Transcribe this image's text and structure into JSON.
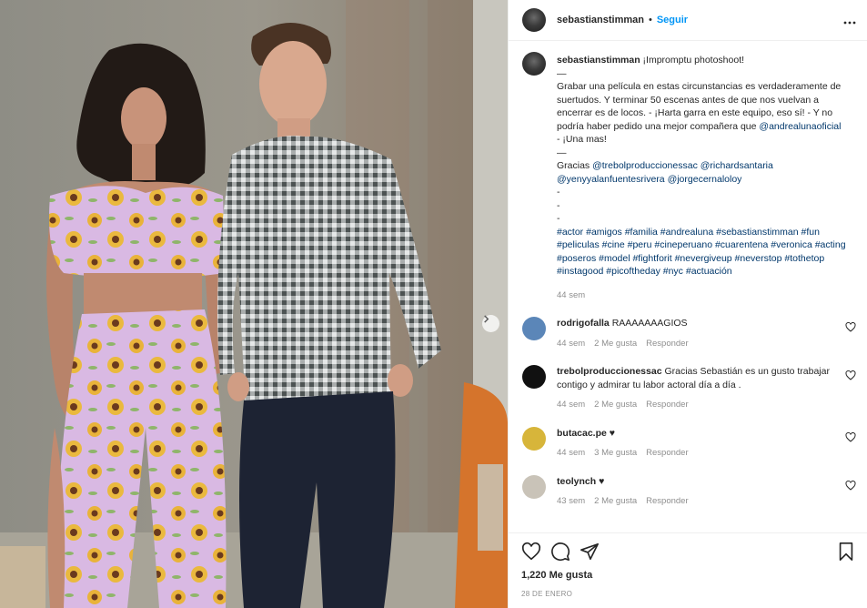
{
  "header": {
    "username": "sebastianstimman",
    "separator": "•",
    "follow_label": "Seguir",
    "more_icon": "more-horizontal-icon"
  },
  "caption": {
    "username": "sebastianstimman",
    "text_1": "¡Impromptu photoshoot!\n—\nGrabar una película en estas circunstancias es verdaderamente de suertudos. Y terminar 50 escenas antes de que nos vuelvan a encerrar es de locos. - ¡Harta garra en este equipo, eso sí! - Y no podría haber pedido una mejor compañera que ",
    "mention_1": "@andrealunaoficial",
    "text_2": "\n- ¡Una mas!\n—\nGracias ",
    "mention_2": "@trebolproduccionessac",
    "mention_3": "@richardsantaria",
    "mention_4": "@yenyyalanfuentesrivera",
    "mention_5": "@jorgecernaloloy",
    "dashes": "-\n-\n-",
    "hashtags": "#actor #amigos #familia #andrealuna #sebastianstimman #fun #peliculas #cine #peru #cineperuano #cuarentena #veronica #acting #poseros #model #fightforit #nevergiveup #neverstop #tothetop #instagood #picoftheday #nyc #actuación",
    "time": "44 sem"
  },
  "comments": [
    {
      "username": "rodrigofalla",
      "text": "RAAAAAAAGIOS",
      "time": "44 sem",
      "likes": "2 Me gusta",
      "reply": "Responder",
      "avatar_color": "#5b86b8"
    },
    {
      "username": "trebolproduccionessac",
      "text": "Gracias Sebastián es un gusto trabajar contigo y admirar tu labor actoral día a día .",
      "time": "44 sem",
      "likes": "2 Me gusta",
      "reply": "Responder",
      "avatar_color": "#111111"
    },
    {
      "username": "butacac.pe",
      "text": "♥",
      "time": "44 sem",
      "likes": "3 Me gusta",
      "reply": "Responder",
      "avatar_color": "#d7b53a"
    },
    {
      "username": "teolynch",
      "text": "♥",
      "time": "43 sem",
      "likes": "2 Me gusta",
      "reply": "Responder",
      "avatar_color": "#c9c3b8"
    }
  ],
  "footer": {
    "likes": "1,220 Me gusta",
    "date": "28 DE ENERO"
  },
  "colors": {
    "link": "#00376b",
    "follow": "#0095f6",
    "meta": "#8e8e8e",
    "border": "#efefef"
  }
}
